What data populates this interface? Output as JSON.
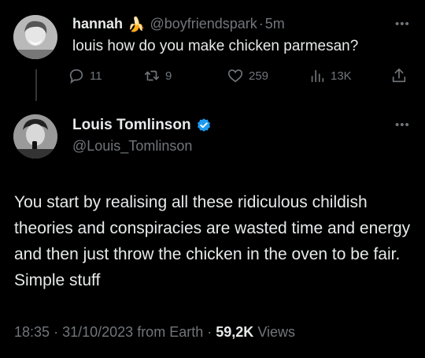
{
  "reply": {
    "author_name": "hannah",
    "author_emoji": "🍌",
    "handle": "@boyfriendspark",
    "separator": "·",
    "time": "5m",
    "text": "louis how do you make chicken parmesan?",
    "counts": {
      "replies": "11",
      "reposts": "9",
      "likes": "259",
      "views": "13K"
    }
  },
  "main": {
    "author_name": "Louis Tomlinson",
    "handle": "@Louis_Tomlinson",
    "verified": true,
    "verified_color": "#1d9bf0",
    "text": "You start by realising all these ridiculous childish theories and conspiracies are wasted time and energy and then just throw the chicken in the oven to be fair. Simple stuff",
    "time": "18:35",
    "date": "31/10/2023",
    "source": "from Earth",
    "views_count": "59,2K",
    "views_label": "Views",
    "separator": "·"
  },
  "icons": {
    "more": "more-options-icon",
    "reply": "reply-icon",
    "repost": "repost-icon",
    "like": "heart-icon",
    "views": "views-icon",
    "share": "share-icon",
    "verified": "verified-badge-icon"
  },
  "colors": {
    "background": "#000000",
    "text": "#e7e9ea",
    "muted": "#71767b",
    "accent": "#1d9bf0"
  }
}
